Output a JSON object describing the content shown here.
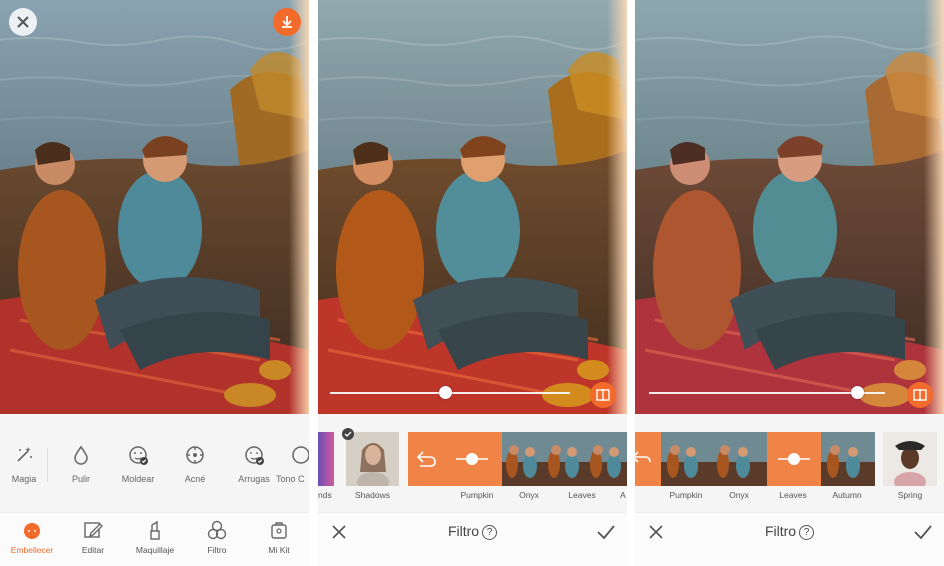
{
  "panel1": {
    "tools": [
      {
        "label": "Magia",
        "icon": "magic-wand-icon"
      },
      {
        "label": "Pulir",
        "icon": "droplet-icon"
      },
      {
        "label": "Moldear",
        "icon": "face-reshape-icon"
      },
      {
        "label": "Acné",
        "icon": "acne-target-icon"
      },
      {
        "label": "Arrugas",
        "icon": "wrinkle-face-icon"
      },
      {
        "label": "Tono C",
        "icon": "skin-tone-icon"
      }
    ],
    "tabs": [
      {
        "label": "Embellecer",
        "icon": "beautify-face-icon",
        "active": true
      },
      {
        "label": "Editar",
        "icon": "edit-pencil-icon",
        "active": false
      },
      {
        "label": "Maquillaje",
        "icon": "lipstick-icon",
        "active": false
      },
      {
        "label": "Filtro",
        "icon": "filter-circles-icon",
        "active": false
      },
      {
        "label": "Mi Kit",
        "icon": "kit-bag-icon",
        "active": false
      }
    ]
  },
  "panel2": {
    "filters": [
      "nds",
      "Shadows",
      "Pumpkin",
      "Onyx",
      "Leaves",
      "A"
    ],
    "selected_filter": "Pumpkin",
    "intensity": 0.48,
    "title": "Filtro",
    "help": "?"
  },
  "panel3": {
    "filters": [
      "Pumpkin",
      "Onyx",
      "Leaves",
      "Autumn",
      "Spring"
    ],
    "selected_filter": "Leaves",
    "intensity": 0.88,
    "title": "Filtro",
    "help": "?"
  },
  "colors": {
    "accent": "#f26b2a",
    "background": "#f5f5f5"
  }
}
